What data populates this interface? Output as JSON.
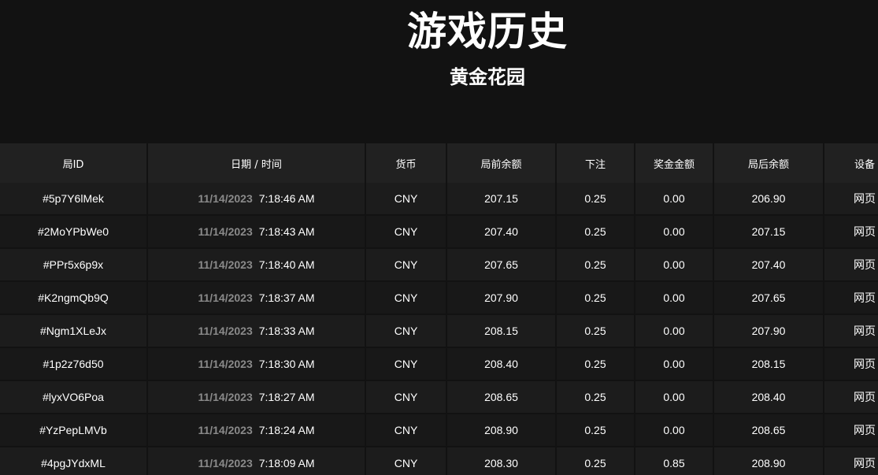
{
  "header": {
    "title": "游戏历史",
    "subtitle": "黄金花园"
  },
  "table": {
    "columns": [
      "局ID",
      "日期 / 时间",
      "货币",
      "局前余额",
      "下注",
      "奖金金额",
      "局后余额",
      "设备"
    ],
    "rows": [
      {
        "id": "#5p7Y6lMek",
        "date": "11/14/2023",
        "time": "7:18:46 AM",
        "currency": "CNY",
        "before": "207.15",
        "bet": "0.25",
        "win": "0.00",
        "after": "206.90",
        "device": "网页"
      },
      {
        "id": "#2MoYPbWe0",
        "date": "11/14/2023",
        "time": "7:18:43 AM",
        "currency": "CNY",
        "before": "207.40",
        "bet": "0.25",
        "win": "0.00",
        "after": "207.15",
        "device": "网页"
      },
      {
        "id": "#PPr5x6p9x",
        "date": "11/14/2023",
        "time": "7:18:40 AM",
        "currency": "CNY",
        "before": "207.65",
        "bet": "0.25",
        "win": "0.00",
        "after": "207.40",
        "device": "网页"
      },
      {
        "id": "#K2ngmQb9Q",
        "date": "11/14/2023",
        "time": "7:18:37 AM",
        "currency": "CNY",
        "before": "207.90",
        "bet": "0.25",
        "win": "0.00",
        "after": "207.65",
        "device": "网页"
      },
      {
        "id": "#Ngm1XLeJx",
        "date": "11/14/2023",
        "time": "7:18:33 AM",
        "currency": "CNY",
        "before": "208.15",
        "bet": "0.25",
        "win": "0.00",
        "after": "207.90",
        "device": "网页"
      },
      {
        "id": "#1p2z76d50",
        "date": "11/14/2023",
        "time": "7:18:30 AM",
        "currency": "CNY",
        "before": "208.40",
        "bet": "0.25",
        "win": "0.00",
        "after": "208.15",
        "device": "网页"
      },
      {
        "id": "#lyxVO6Poa",
        "date": "11/14/2023",
        "time": "7:18:27 AM",
        "currency": "CNY",
        "before": "208.65",
        "bet": "0.25",
        "win": "0.00",
        "after": "208.40",
        "device": "网页"
      },
      {
        "id": "#YzPepLMVb",
        "date": "11/14/2023",
        "time": "7:18:24 AM",
        "currency": "CNY",
        "before": "208.90",
        "bet": "0.25",
        "win": "0.00",
        "after": "208.65",
        "device": "网页"
      },
      {
        "id": "#4pgJYdxML",
        "date": "11/14/2023",
        "time": "7:18:09 AM",
        "currency": "CNY",
        "before": "208.30",
        "bet": "0.25",
        "win": "0.85",
        "after": "208.90",
        "device": "网页"
      }
    ]
  }
}
